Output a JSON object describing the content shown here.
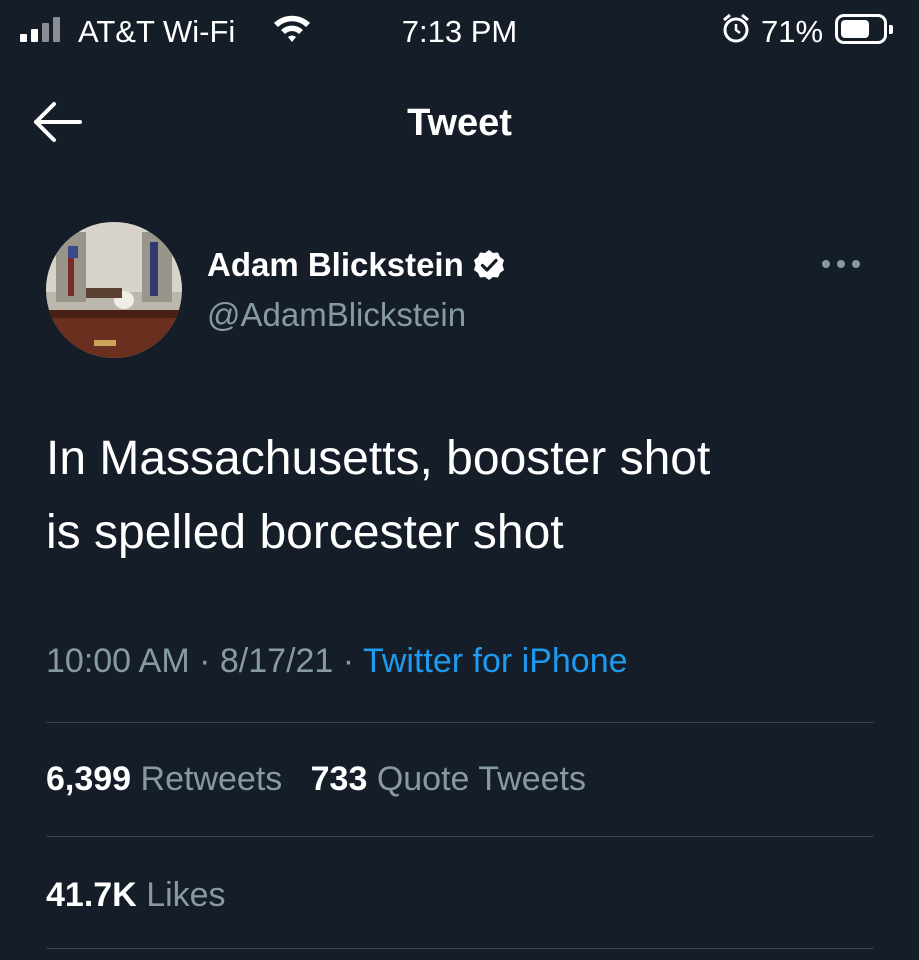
{
  "status_bar": {
    "carrier": "AT&T Wi-Fi",
    "time": "7:13 PM",
    "battery": "71%",
    "battery_level": 0.71,
    "icons": [
      "signal-icon",
      "wifi-icon",
      "alarm-icon",
      "battery-icon"
    ]
  },
  "nav": {
    "back_icon": "back-arrow-icon",
    "title": "Tweet"
  },
  "tweet": {
    "author_name": "Adam Blickstein",
    "verified": true,
    "handle": "@AdamBlickstein",
    "text_line1": "In Massachusetts, booster shot",
    "text_line2": "is spelled borcester shot",
    "time": "10:00 AM",
    "separator": "·",
    "date": "8/17/21",
    "source": "Twitter for iPhone",
    "retweets_count": "6,399",
    "retweets_label": "Retweets",
    "quotes_count": "733",
    "quotes_label": "Quote Tweets",
    "likes_count": "41.7K",
    "likes_label": "Likes"
  },
  "colors": {
    "background": "#151d29",
    "text": "#ffffff",
    "secondary": "#8899a6",
    "link": "#1d9bf0",
    "divider": "#38444d"
  }
}
